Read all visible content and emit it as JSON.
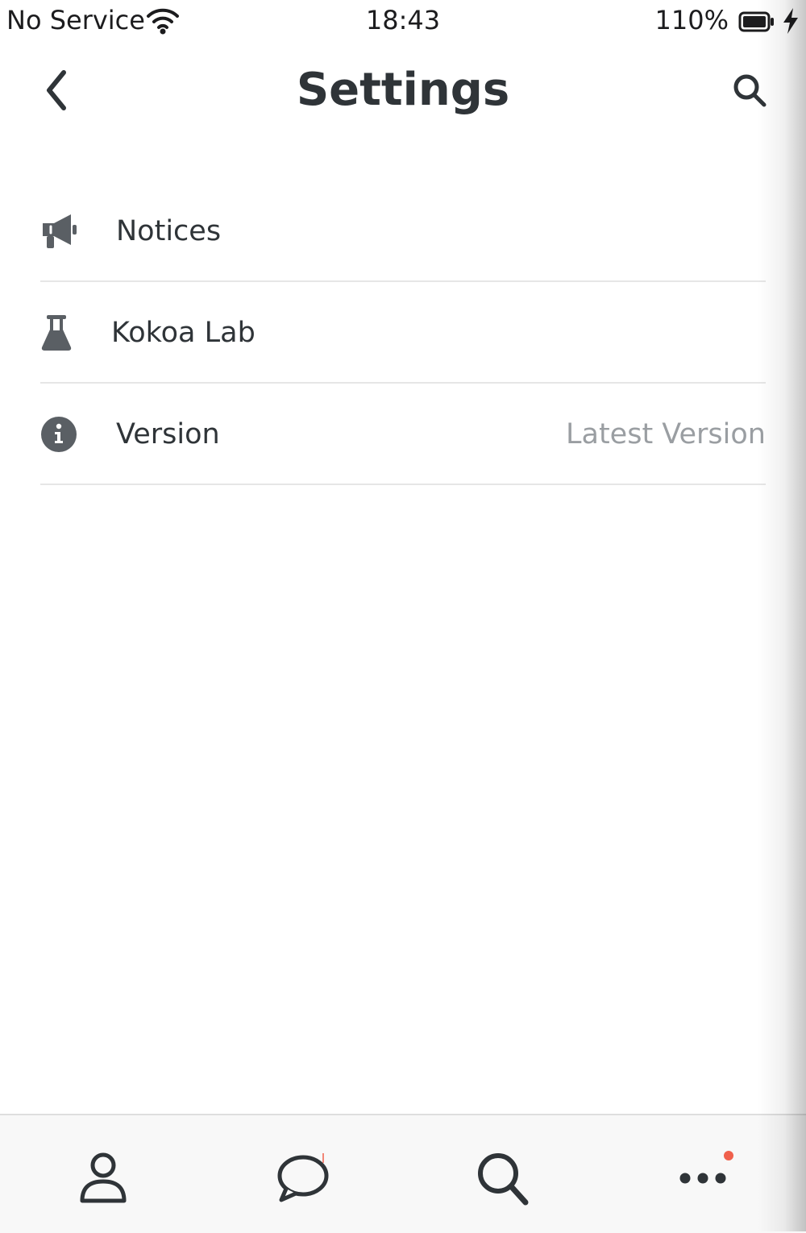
{
  "status_bar": {
    "carrier": "No Service",
    "time": "18:43",
    "battery_percent": "110%",
    "icons": [
      "wifi-icon",
      "battery-icon",
      "charging-bolt-icon"
    ]
  },
  "header": {
    "title": "Settings",
    "back_icon": "chevron-left-icon",
    "search_icon": "search-icon"
  },
  "settings": {
    "items": [
      {
        "label": "Notices",
        "icon": "megaphone-icon"
      },
      {
        "label": "Kokoa Lab",
        "icon": "flask-icon"
      },
      {
        "label": "Version",
        "icon": "info-icon",
        "value": "Latest Version"
      }
    ]
  },
  "tab_bar": {
    "tabs": [
      {
        "name": "profile",
        "icon": "person-icon"
      },
      {
        "name": "chats",
        "icon": "chat-bubble-icon"
      },
      {
        "name": "search",
        "icon": "search-icon"
      },
      {
        "name": "more",
        "icon": "more-dots-icon",
        "badge": true
      }
    ]
  },
  "colors": {
    "text": "#2f3438",
    "muted": "#9a9ea2",
    "badge": "#f0604c",
    "divider": "#e6e6e6"
  }
}
